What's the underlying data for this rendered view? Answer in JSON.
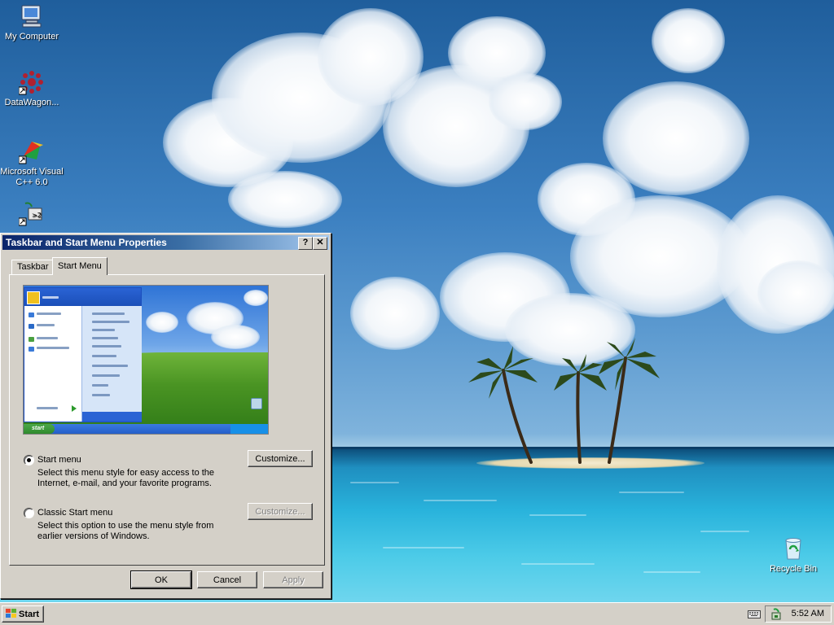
{
  "desktop": {
    "icons": [
      {
        "label": "My Computer",
        "icon": "my-computer-icon"
      },
      {
        "label": "DataWagon...",
        "icon": "datawagon-shortcut-icon"
      },
      {
        "label": "Microsoft Visual",
        "label2": "C++ 6.0",
        "icon": "visual-cpp-shortcut-icon"
      },
      {
        "label": "",
        "icon": "network-shortcut-icon"
      },
      {
        "label": "Recycle Bin",
        "icon": "recycle-bin-icon"
      }
    ]
  },
  "dialog": {
    "title": "Taskbar and Start Menu Properties",
    "help_glyph": "?",
    "close_glyph": "✕",
    "tabs": [
      {
        "label": "Taskbar",
        "active": false
      },
      {
        "label": "Start Menu",
        "active": true
      }
    ],
    "preview": {
      "start_label": "start"
    },
    "options": [
      {
        "label": "Start menu",
        "selected": true,
        "desc_line1": "Select this menu style for easy access to the",
        "desc_line2": "Internet, e-mail, and your favorite programs.",
        "button": "Customize...",
        "button_enabled": true
      },
      {
        "label": "Classic Start menu",
        "selected": false,
        "desc_line1": "Select this option to use the menu style from",
        "desc_line2": "earlier versions of Windows.",
        "button": "Customize...",
        "button_enabled": false
      }
    ],
    "buttons": {
      "ok": "OK",
      "cancel": "Cancel",
      "apply": "Apply"
    }
  },
  "taskbar": {
    "start_label": "Start",
    "clock": "5:52 AM",
    "tray_icons": [
      "keyboard-icon",
      "network-tray-icon"
    ]
  },
  "colors": {
    "titlebar_start": "#0a246a",
    "titlebar_end": "#a6caf0",
    "window_face": "#d4d0c8"
  }
}
